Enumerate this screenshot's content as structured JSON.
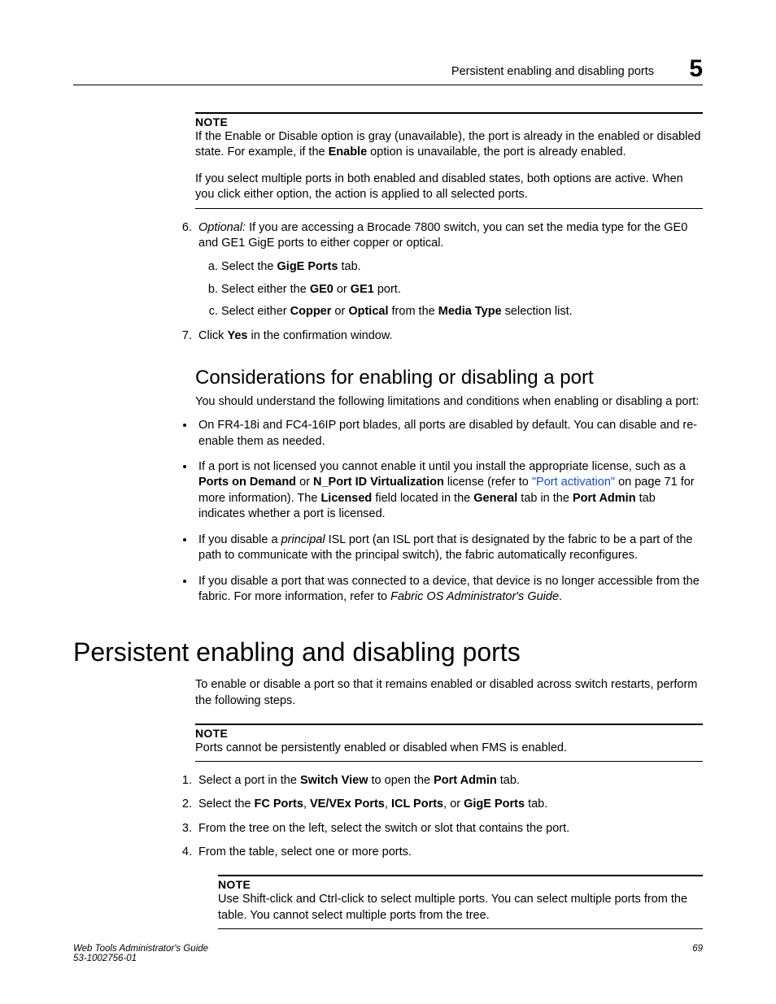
{
  "header": {
    "title": "Persistent enabling and disabling ports",
    "chapter": "5"
  },
  "note1": {
    "label": "NOTE",
    "text_a": "If the Enable or Disable option is gray (unavailable), the port is already in the enabled or disabled state. For example, if the ",
    "enable": "Enable",
    "text_b": " option is unavailable, the port is already enabled.",
    "para2": "If you select multiple ports in both enabled and disabled states, both options are active. When you click either option, the action is applied to all selected ports."
  },
  "step6": {
    "num": "6.",
    "optional": "Optional:",
    "text": " If you are accessing a Brocade 7800 switch, you can set the media type for the GE0 and GE1 GigE ports to either copper or optical.",
    "a_pre": "Select the ",
    "a_bold": "GigE Ports",
    "a_post": " tab.",
    "b_pre": "Select either the ",
    "b_b1": "GE0",
    "b_mid": " or ",
    "b_b2": "GE1",
    "b_post": " port.",
    "c_pre": "Select either ",
    "c_b1": "Copper",
    "c_mid1": " or ",
    "c_b2": "Optical",
    "c_mid2": " from the ",
    "c_b3": "Media Type",
    "c_post": " selection list."
  },
  "step7": {
    "num": "7.",
    "pre": "Click ",
    "bold": "Yes",
    "post": " in the confirmation window."
  },
  "h2": "Considerations for enabling or disabling a port",
  "considerations_intro": "You should understand the following limitations and conditions when enabling or disabling a port:",
  "bul1": "On FR4-18i and FC4-16IP port blades, all ports are disabled by default. You can disable and re-enable them as needed.",
  "bul2": {
    "a": "If a port is not licensed you cannot enable it until you install the appropriate license, such as a ",
    "b1": "Ports on Demand",
    "mid1": " or ",
    "b2": "N_Port ID Virtualization",
    "mid2": " license (refer to ",
    "link": "\"Port activation\"",
    "after_link": " on page 71 for more information). The ",
    "b3": "Licensed",
    "mid3": " field located in the ",
    "b4": "General",
    "mid4": " tab in the ",
    "b5": "Port Admin",
    "mid5": " tab indicates whether a port is licensed."
  },
  "bul3": {
    "a": "If you disable a ",
    "it": "principal",
    "b": " ISL port (an ISL port that is designated by the fabric to be a part of the path to communicate with the principal switch), the fabric automatically reconfigures."
  },
  "bul4": {
    "a": "If you disable a port that was connected to a device, that device is no longer accessible from the fabric. For more information, refer to ",
    "it": "Fabric OS Administrator's Guide",
    "b": "."
  },
  "h1": "Persistent enabling and disabling ports",
  "persist_intro": "To enable or disable a port so that it remains enabled or disabled across switch restarts, perform the following steps.",
  "note2": {
    "label": "NOTE",
    "text": "Ports cannot be persistently enabled or disabled when FMS is enabled."
  },
  "ps1": {
    "pre": "Select a port in the ",
    "b1": "Switch View",
    "mid": " to open the ",
    "b2": "Port Admin",
    "post": " tab."
  },
  "ps2": {
    "pre": "Select the ",
    "b1": "FC Ports",
    "c1": ", ",
    "b2": "VE/VEx Ports",
    "c2": ", ",
    "b3": "ICL Ports",
    "c3": ", or ",
    "b4": "GigE Ports",
    "post": " tab."
  },
  "ps3": "From the tree on the left, select the switch or slot that contains the port.",
  "ps4": "From the table, select one or more ports.",
  "note3": {
    "label": "NOTE",
    "text": "Use Shift-click and Ctrl-click to select multiple ports. You can select multiple ports from the table. You cannot select multiple ports from the tree."
  },
  "footer": {
    "line1": "Web Tools Administrator's Guide",
    "line2": "53-1002756-01",
    "page": "69"
  }
}
